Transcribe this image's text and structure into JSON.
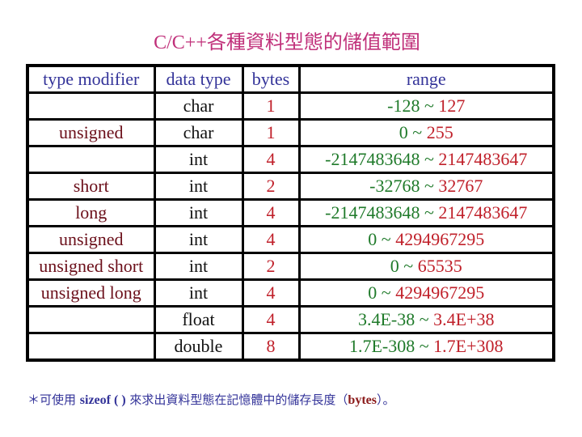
{
  "title": "C/C++各種資料型態的儲值範圍",
  "table": {
    "headers": [
      "type modifier",
      "data type",
      "bytes",
      "range"
    ],
    "rows": [
      {
        "modifier": "",
        "type": "char",
        "bytes": "1",
        "min": "-128",
        "sep": " ~ ",
        "max": "127"
      },
      {
        "modifier": "unsigned",
        "type": "char",
        "bytes": "1",
        "min": "0",
        "sep": " ~ ",
        "max": "255"
      },
      {
        "modifier": "",
        "type": "int",
        "bytes": "4",
        "min": "-2147483648",
        "sep": " ~ ",
        "max": "2147483647"
      },
      {
        "modifier": "short",
        "type": "int",
        "bytes": "2",
        "min": "-32768",
        "sep": " ~ ",
        "max": "32767"
      },
      {
        "modifier": "long",
        "type": "int",
        "bytes": "4",
        "min": "-2147483648",
        "sep": " ~ ",
        "max": "2147483647"
      },
      {
        "modifier": "unsigned",
        "type": "int",
        "bytes": "4",
        "min": "0",
        "sep": " ~ ",
        "max": "4294967295"
      },
      {
        "modifier": "unsigned short",
        "type": "int",
        "bytes": "2",
        "min": "0",
        "sep": " ~ ",
        "max": "65535"
      },
      {
        "modifier": "unsigned long",
        "type": "int",
        "bytes": "4",
        "min": "0",
        "sep": " ~ ",
        "max": "4294967295"
      },
      {
        "modifier": "",
        "type": "float",
        "bytes": "4",
        "min": "3.4E-38",
        "sep": " ~ ",
        "max": "3.4E+38"
      },
      {
        "modifier": "",
        "type": "double",
        "bytes": "8",
        "min": "1.7E-308",
        "sep": " ~ ",
        "max": "1.7E+308"
      }
    ]
  },
  "note": {
    "prefix": "＊可使用 ",
    "keyword": "sizeof ( )",
    "middle": " 來求出資料型態在記憶體中的儲存長度（",
    "unit": "bytes",
    "suffix": "）。"
  }
}
